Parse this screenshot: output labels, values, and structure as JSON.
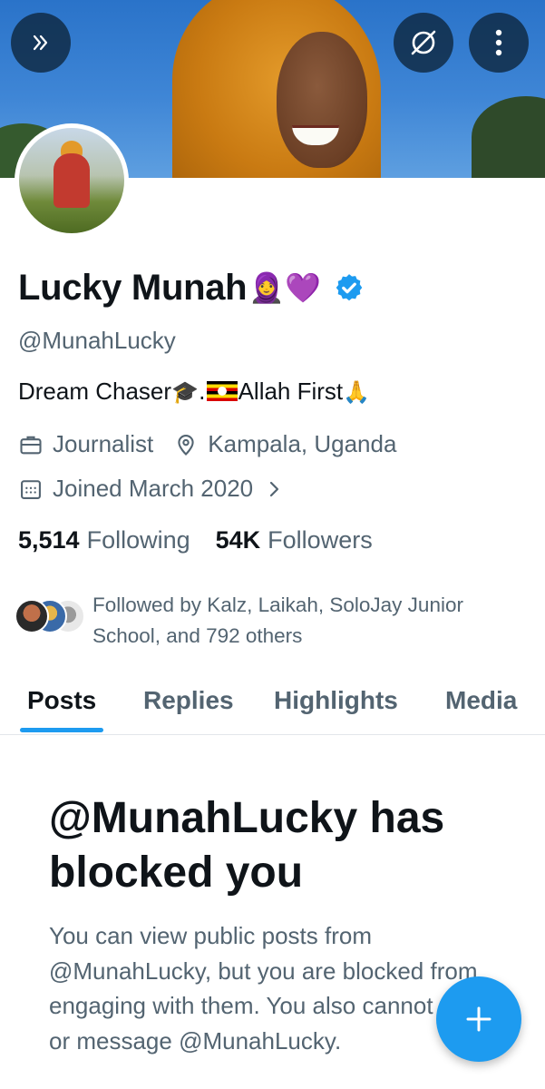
{
  "header": {
    "expand_icon": "double-chevron-right-icon",
    "hide_media_icon": "eye-slash-icon",
    "more_icon": "more-vertical-icon"
  },
  "profile": {
    "name": "Lucky Munah",
    "name_emoji": "🧕💜",
    "verified": true,
    "handle": "@MunahLucky",
    "bio_part1": "Dream Chaser",
    "bio_emoji1": "🎓.",
    "bio_part2": "Allah First",
    "bio_emoji2": "🙏",
    "category": "Journalist",
    "location": "Kampala, Uganda",
    "joined": "Joined March 2020",
    "following_count": "5,514",
    "following_label": "Following",
    "followers_count": "54K",
    "followers_label": "Followers",
    "followed_by": "Followed by Kalz, Laikah, SoloJay Junior School, and 792 others"
  },
  "tabs": [
    {
      "label": "Posts",
      "active": true
    },
    {
      "label": "Replies",
      "active": false
    },
    {
      "label": "Highlights",
      "active": false
    },
    {
      "label": "Media",
      "active": false
    }
  ],
  "blocked": {
    "title": "@MunahLucky has blocked you",
    "description": "You can view public posts from @MunahLucky, but you are blocked from engaging with them. You also cannot follow or message @MunahLucky."
  },
  "fab": {
    "icon": "plus-icon"
  },
  "colors": {
    "accent": "#1d9bf0",
    "text_primary": "#0f1419",
    "text_secondary": "#536471"
  }
}
